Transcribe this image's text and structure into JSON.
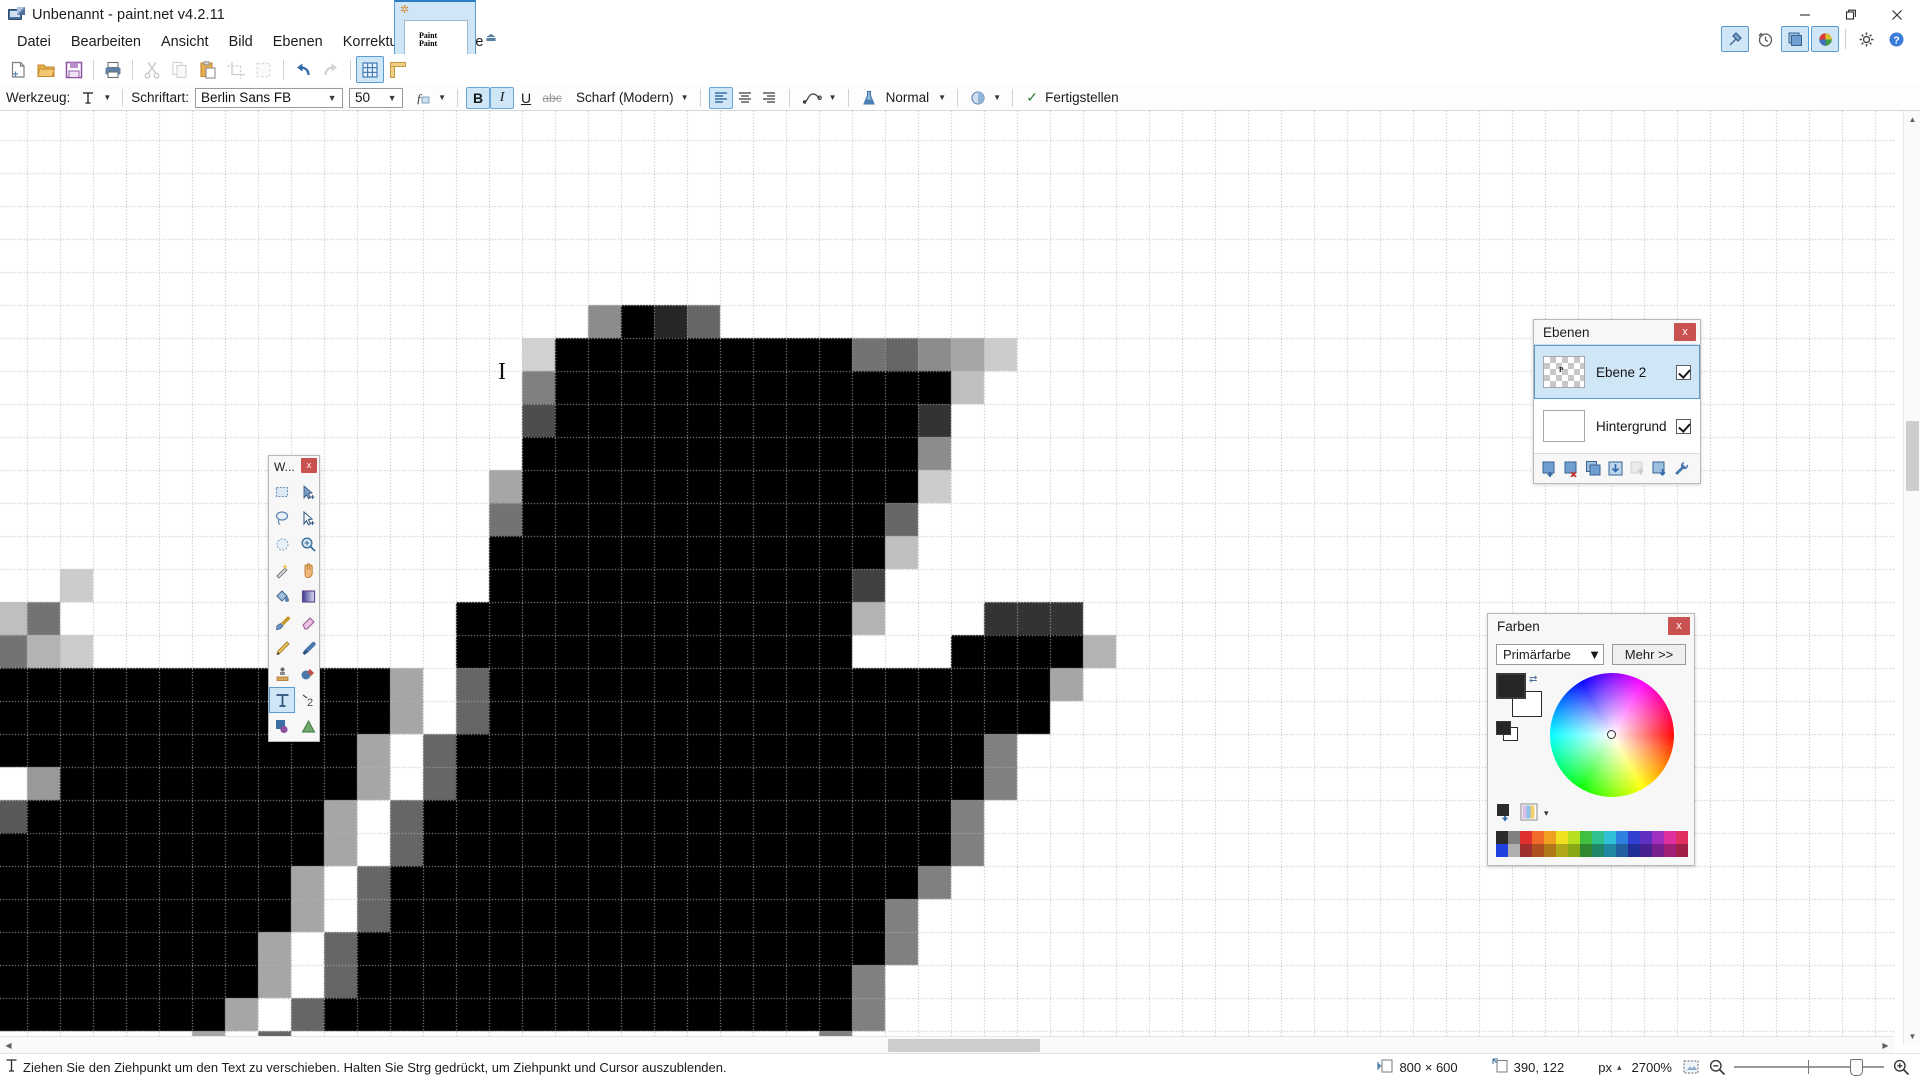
{
  "window": {
    "title": "Unbenannt - paint.net v4.2.11",
    "icon": "paintnet-app-icon",
    "controls": {
      "minimize": "—",
      "maximize": "❐",
      "close": "✕"
    }
  },
  "menubar": {
    "items": [
      {
        "label": "Datei"
      },
      {
        "label": "Bearbeiten"
      },
      {
        "label": "Ansicht"
      },
      {
        "label": "Bild"
      },
      {
        "label": "Ebenen"
      },
      {
        "label": "Korrekturen"
      },
      {
        "label": "Effekte"
      }
    ]
  },
  "image_tab": {
    "close_glyph": "✲",
    "thumbnail_text_line1": "Paint",
    "thumbnail_text_line2": "Paint",
    "overflow_glyph": "⏏"
  },
  "panel_toggles": {
    "items": [
      {
        "name": "tools-toggle",
        "glyph": "⚒",
        "active": true
      },
      {
        "name": "history-toggle",
        "glyph": "↺",
        "active": false
      },
      {
        "name": "layers-toggle",
        "glyph": "❐",
        "active": true
      },
      {
        "name": "colors-toggle",
        "glyph": "◕",
        "active": true
      },
      {
        "name": "settings-button",
        "glyph": "⚙",
        "active": false
      },
      {
        "name": "help-button",
        "glyph": "?",
        "active": false
      }
    ]
  },
  "toolbar": {
    "buttons": [
      {
        "name": "new-image",
        "label": "Neu",
        "state": "normal"
      },
      {
        "name": "open-image",
        "label": "Öffnen",
        "state": "normal"
      },
      {
        "name": "save-image",
        "label": "Speichern",
        "state": "normal"
      },
      {
        "name": "print-image",
        "label": "Drucken",
        "state": "normal"
      },
      {
        "name": "cut",
        "label": "Ausschneiden",
        "state": "dim"
      },
      {
        "name": "copy",
        "label": "Kopieren",
        "state": "dim"
      },
      {
        "name": "paste",
        "label": "Einfügen",
        "state": "normal"
      },
      {
        "name": "crop-to-selection",
        "label": "Auf Auswahl zuschneiden",
        "state": "dim"
      },
      {
        "name": "deselect-all",
        "label": "Auswahl aufheben",
        "state": "dim"
      },
      {
        "name": "undo",
        "label": "Rückgängig",
        "state": "normal"
      },
      {
        "name": "redo",
        "label": "Wiederholen",
        "state": "dim"
      },
      {
        "name": "toggle-grid",
        "label": "Raster",
        "state": "active"
      },
      {
        "name": "toggle-rulers",
        "label": "Lineale",
        "state": "normal"
      }
    ]
  },
  "options_bar": {
    "tool_label": "Werkzeug:",
    "tool_value": "Text",
    "font_label": "Schriftart:",
    "font_value": "Berlin Sans FB",
    "size_value": "50",
    "font_effects_glyph": "ƒ",
    "bold": {
      "label": "B",
      "active": true
    },
    "italic": {
      "label": "I",
      "active": true
    },
    "underline": {
      "label": "U",
      "active": false
    },
    "strikethrough": {
      "label": "abc",
      "active": false
    },
    "antialias_value": "Scharf (Modern)",
    "align": [
      {
        "name": "align-left",
        "active": true
      },
      {
        "name": "align-center",
        "active": false
      },
      {
        "name": "align-right",
        "active": false
      }
    ],
    "curve_glyph": "∿",
    "blend_label": "Normal",
    "finish_label": "Fertigstellen",
    "finish_check": "✓"
  },
  "tools_panel": {
    "title": "W...",
    "close": "x",
    "tools": [
      {
        "name": "rectangle-select-tool",
        "glyph": "▭",
        "active": false
      },
      {
        "name": "move-selected-tool",
        "glyph": "↖",
        "active": false
      },
      {
        "name": "lasso-select-tool",
        "glyph": "☁",
        "active": false
      },
      {
        "name": "move-selection-tool",
        "glyph": "▷",
        "active": false
      },
      {
        "name": "ellipse-select-tool",
        "glyph": "◯",
        "active": false
      },
      {
        "name": "zoom-tool",
        "glyph": "⌕",
        "active": false
      },
      {
        "name": "magic-wand-tool",
        "glyph": "✨",
        "active": false
      },
      {
        "name": "pan-tool",
        "glyph": "✋",
        "active": false
      },
      {
        "name": "paint-bucket-tool",
        "glyph": "⬇",
        "active": false
      },
      {
        "name": "gradient-tool",
        "glyph": "▣",
        "active": false
      },
      {
        "name": "paintbrush-tool",
        "glyph": "✐",
        "active": false
      },
      {
        "name": "eraser-tool",
        "glyph": "▱",
        "active": false
      },
      {
        "name": "pencil-tool",
        "glyph": "✎",
        "active": false
      },
      {
        "name": "color-picker-tool",
        "glyph": "✒",
        "active": false
      },
      {
        "name": "clone-stamp-tool",
        "glyph": "⎙",
        "active": false
      },
      {
        "name": "recolor-tool",
        "glyph": "◐",
        "active": false
      },
      {
        "name": "text-tool",
        "glyph": "T",
        "active": true
      },
      {
        "name": "line-curve-tool",
        "glyph": "⤵",
        "active": false
      },
      {
        "name": "shapes-tool",
        "glyph": "◼",
        "active": false
      },
      {
        "name": "shapes-extra-tool",
        "glyph": "△",
        "active": false
      }
    ]
  },
  "layers_panel": {
    "title": "Ebenen",
    "close": "x",
    "layers": [
      {
        "name": "Ebene 2",
        "visible": true,
        "selected": true,
        "thumb": "checker",
        "thumb_text": "P"
      },
      {
        "name": "Hintergrund",
        "visible": true,
        "selected": false,
        "thumb": "white",
        "thumb_text": ""
      }
    ],
    "buttons": [
      {
        "name": "add-layer-button",
        "state": "normal"
      },
      {
        "name": "delete-layer-button",
        "state": "normal"
      },
      {
        "name": "duplicate-layer-button",
        "state": "normal"
      },
      {
        "name": "merge-layer-down-button",
        "state": "normal"
      },
      {
        "name": "move-layer-up-button",
        "state": "dim"
      },
      {
        "name": "move-layer-down-button",
        "state": "normal"
      },
      {
        "name": "layer-properties-button",
        "state": "normal"
      }
    ]
  },
  "colors_panel": {
    "title": "Farben",
    "close": "x",
    "mode_value": "Primärfarbe",
    "more_label": "Mehr >>",
    "primary_color": "#262626",
    "secondary_color": "#ffffff",
    "swap_glyph": "⇄",
    "wheel_marker_position": "center",
    "add_palette_icon": "add-color-icon",
    "palette_icon": "palette-icon",
    "palette_dropdown_glyph": "▾",
    "palette_row1": [
      "#2b2b2b",
      "#808080",
      "#e03030",
      "#f06a2a",
      "#f0a020",
      "#f0e020",
      "#b8e020",
      "#40c040",
      "#30c090",
      "#30c0d8",
      "#3080e0",
      "#3040d0",
      "#6030c0",
      "#a030c0",
      "#e030a0",
      "#e03060"
    ],
    "palette_row2": [
      "#2040e0",
      "#b0b0b0",
      "#a03030",
      "#b05020",
      "#b07818",
      "#b0a818",
      "#88a818",
      "#308830",
      "#208868",
      "#2088a0",
      "#2060a0",
      "#203098",
      "#482090",
      "#782090",
      "#a02078",
      "#a02048"
    ]
  },
  "status_bar": {
    "hint_icon": "text-tool-icon",
    "hint_text": "Ziehen Sie den Ziehpunkt um den Text zu verschieben. Halten Sie Strg gedrückt, um Ziehpunkt und Cursor auszublenden.",
    "image_size_icon": "image-size-icon",
    "image_size": "800 × 600",
    "cursor_icon": "cursor-position-icon",
    "cursor_position": "390, 122",
    "units": "px",
    "units_arrow": "▴",
    "zoom_level": "2700%",
    "fit_icon": "fit-to-window-icon",
    "zoom_out_icon": "zoom-out-icon",
    "zoom_in_icon": "zoom-in-icon"
  },
  "canvas": {
    "zoom_percent": 2700,
    "pixel_block_size": 33,
    "grid_color": "#b9b9b9",
    "background": "#ffffff",
    "text_cursor_glyph": "I",
    "artwork_description": "Stark vergrößerter schwarzer Text mit antialiasierten Graustufen-Pixeln auf Rasterhintergrund"
  }
}
